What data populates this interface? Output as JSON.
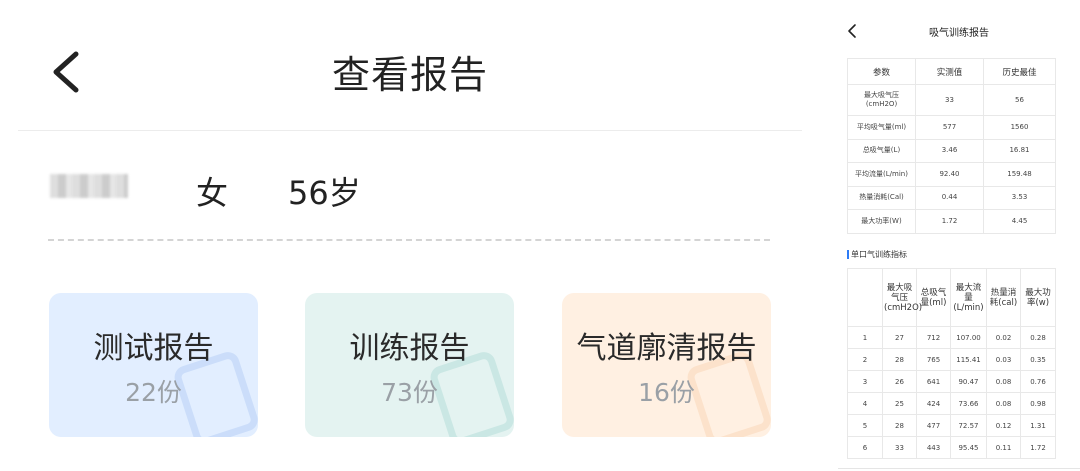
{
  "main": {
    "title": "查看报告",
    "patient": {
      "gender": "女",
      "age": "56岁"
    },
    "cards": [
      {
        "title": "测试报告",
        "count": "22份"
      },
      {
        "title": "训练报告",
        "count": "73份"
      },
      {
        "title": "气道廓清报告",
        "count": "16份"
      }
    ],
    "colors": {
      "card_test": "#e2eeff",
      "card_train": "#e4f3f1",
      "card_airway": "#fff0e2"
    }
  },
  "report": {
    "title": "吸气训练报告",
    "summary_headers": [
      "参数",
      "实测值",
      "历史最佳"
    ],
    "summary_rows": [
      [
        "最大吸气压\n(cmH2O)",
        "33",
        "56"
      ],
      [
        "平均吸气量(ml)",
        "577",
        "1560"
      ],
      [
        "总吸气量(L)",
        "3.46",
        "16.81"
      ],
      [
        "平均流量(L/min)",
        "92.40",
        "159.48"
      ],
      [
        "热量消耗(Cal)",
        "0.44",
        "3.53"
      ],
      [
        "最大功率(W)",
        "1.72",
        "4.45"
      ]
    ],
    "section_title": "单口气训练指标",
    "detail_headers": [
      "",
      "最大吸气压(cmH2O)",
      "总吸气量(ml)",
      "最大流量(L/min)",
      "热量消耗(cal)",
      "最大功率(w)"
    ],
    "detail_rows": [
      [
        "1",
        "27",
        "712",
        "107.00",
        "0.02",
        "0.28"
      ],
      [
        "2",
        "28",
        "765",
        "115.41",
        "0.03",
        "0.35"
      ],
      [
        "3",
        "26",
        "641",
        "90.47",
        "0.08",
        "0.76"
      ],
      [
        "4",
        "25",
        "424",
        "73.66",
        "0.08",
        "0.98"
      ],
      [
        "5",
        "28",
        "477",
        "72.57",
        "0.12",
        "1.31"
      ],
      [
        "6",
        "33",
        "443",
        "95.45",
        "0.11",
        "1.72"
      ]
    ],
    "accent": "#2e7cf6"
  }
}
